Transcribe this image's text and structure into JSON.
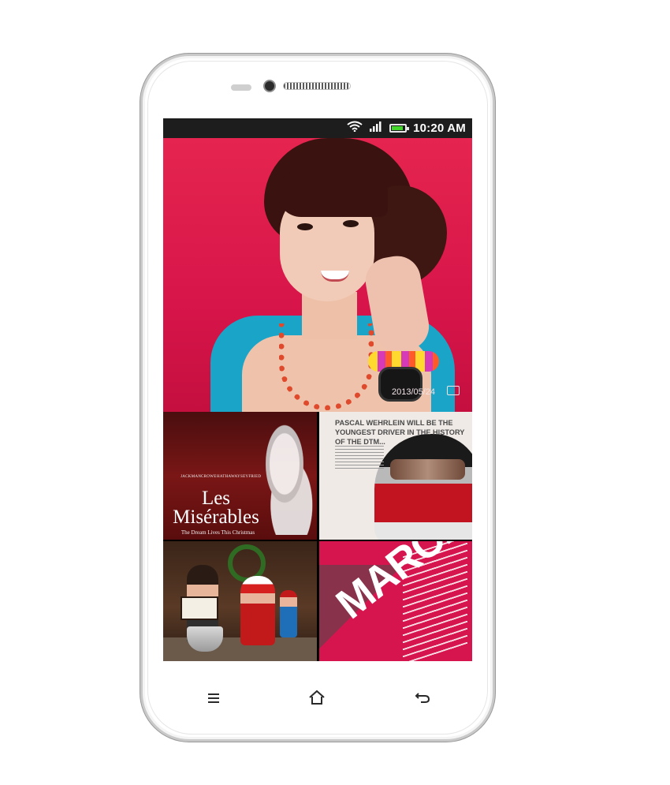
{
  "status_bar": {
    "time": "10:20 AM",
    "icons": [
      "wifi-icon",
      "signal-icon",
      "battery-icon"
    ],
    "battery_level": 1.0,
    "battery_color": "#44d82c"
  },
  "screen": {
    "hero_photo": {
      "date_text": "2013/05/24"
    },
    "tiles": {
      "les_miserables": {
        "title_line1": "Les",
        "title_line2": "Misérables",
        "tagline": "The Dream Lives This Christmas",
        "cast": [
          "JACKMAN",
          "CROWE",
          "HATHAWAY",
          "SEYFRIED"
        ]
      },
      "dtm": {
        "headline": "PASCAL WEHRLEIN WILL BE THE YOUNGEST DRIVER IN THE HISTORY OF THE DTM..."
      },
      "march": {
        "word": "MARCH"
      }
    }
  },
  "nav": {
    "menu_icon": "menu-icon",
    "home_icon": "home-icon",
    "back_icon": "back-icon"
  },
  "colors": {
    "hero_background": "#e5254f",
    "march_background": "#d6144e",
    "phone_body": "#ffffff"
  }
}
